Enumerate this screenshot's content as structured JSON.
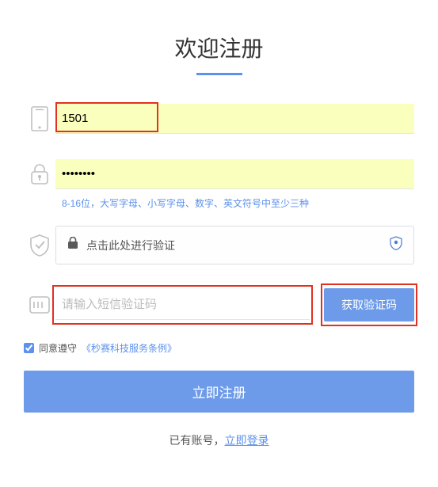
{
  "title": "欢迎注册",
  "phone": {
    "value": "1501"
  },
  "password": {
    "value": "••••••••",
    "hint": "8-16位，大写字母、小写字母、数字、英文符号中至少三种"
  },
  "captcha": {
    "text": "点击此处进行验证"
  },
  "sms": {
    "placeholder": "请输入短信验证码",
    "button": "获取验证码"
  },
  "terms": {
    "prefix": "同意遵守",
    "link": "《秒赛科技服务条例》"
  },
  "register_button": "立即注册",
  "login": {
    "prefix": "已有账号，",
    "link": "立即登录"
  }
}
